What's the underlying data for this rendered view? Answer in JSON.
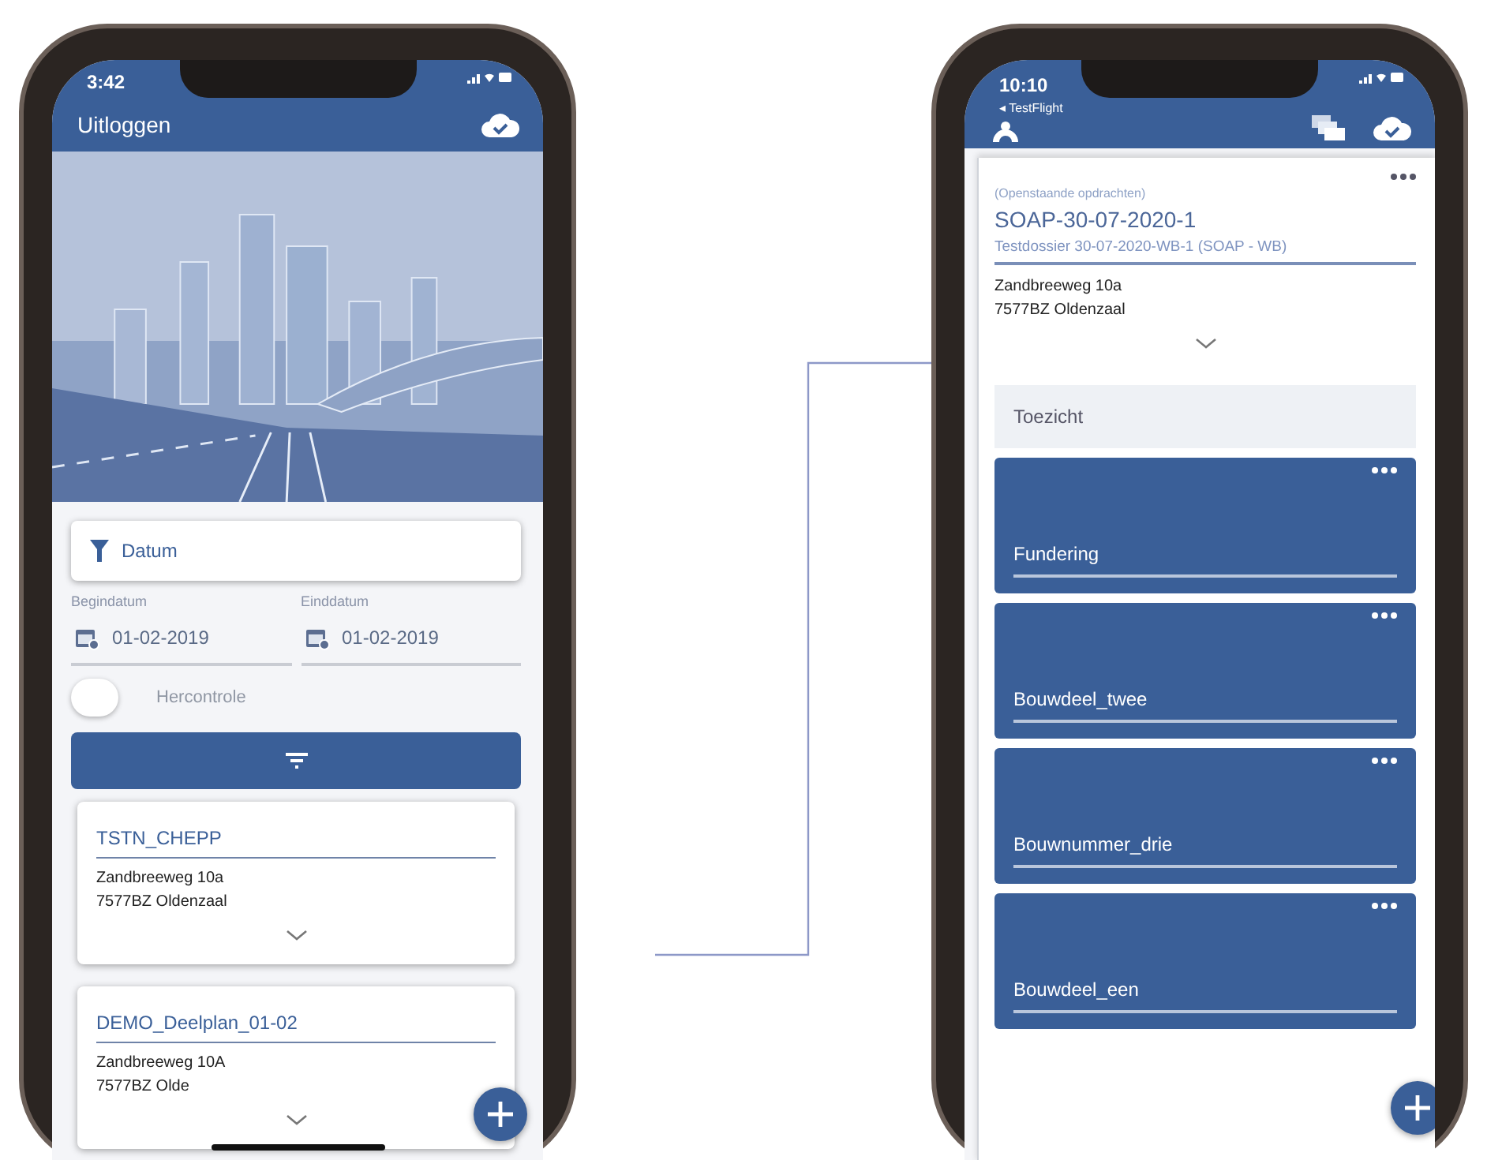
{
  "overview_screen": {
    "status_bar": {
      "time": "3:42"
    },
    "header": {
      "title": "Uitloggen"
    },
    "filter": {
      "label": "Datum"
    },
    "date_fields": [
      {
        "label": "Begindatum",
        "value": "01-02-2019"
      },
      {
        "label": "Einddatum",
        "value": "01-02-2019"
      }
    ],
    "recheck_toggle": {
      "label": "Hercontrole",
      "on": false
    },
    "cards": [
      {
        "title": "TSTN_CHEPP",
        "address": "Zandbreeweg 10a",
        "city": "7577BZ Oldenzaal"
      },
      {
        "title": "DEMO_Deelplan_01-02",
        "address": "Zandbreeweg 10A",
        "city": "7577BZ Olde"
      }
    ]
  },
  "detail_screen": {
    "status_bar": {
      "time": "10:10",
      "back_label": "◂ TestFlight"
    },
    "assignment": {
      "status": "(Openstaande opdrachten)",
      "title": "SOAP-30-07-2020-1",
      "dossier": "Testdossier 30-07-2020-WB-1 (SOAP - WB)",
      "address": "Zandbreeweg 10a",
      "city": "7577BZ Oldenzaal"
    },
    "section": {
      "title": "Toezicht"
    },
    "items": [
      {
        "name": "Fundering"
      },
      {
        "name": "Bouwdeel_twee"
      },
      {
        "name": "Bouwnummer_drie"
      },
      {
        "name": "Bouwdeel_een"
      }
    ]
  }
}
